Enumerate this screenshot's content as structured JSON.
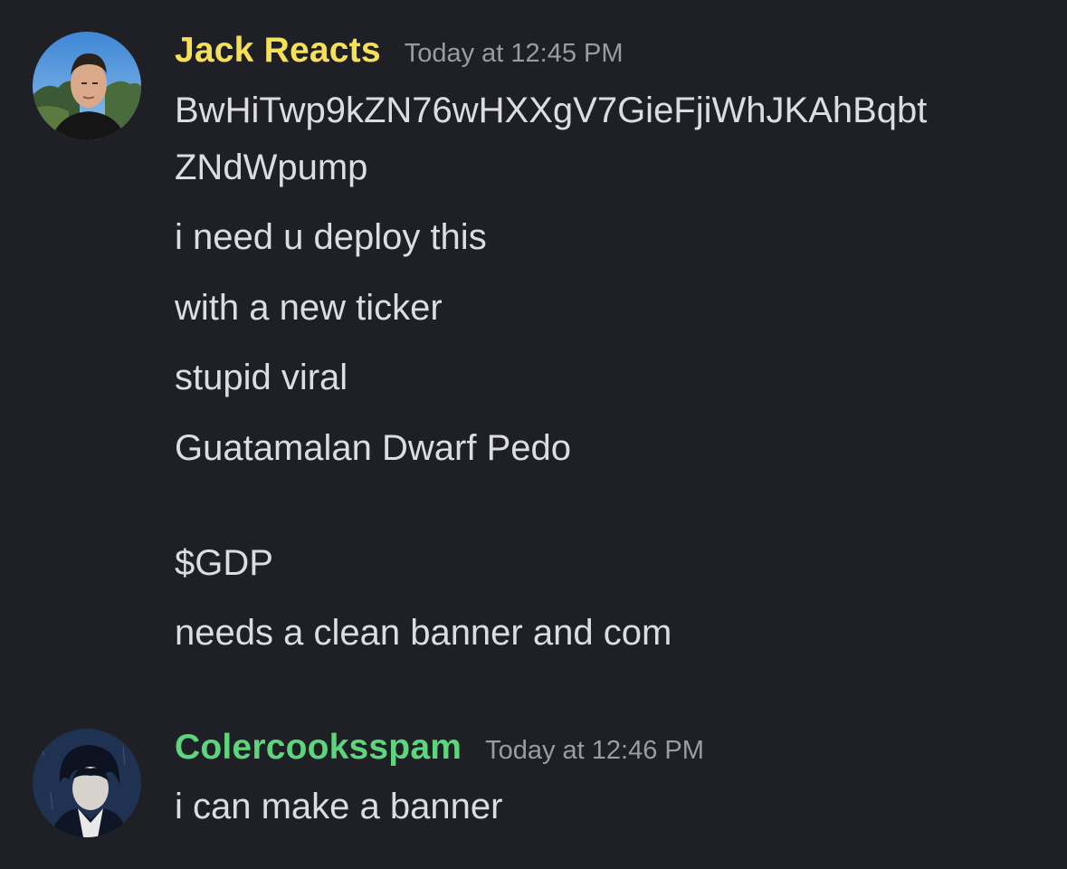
{
  "messages": [
    {
      "username": "Jack Reacts",
      "username_color": "#f6e05a",
      "timestamp": "Today at 12:45 PM",
      "lines": [
        "BwHiTwp9kZN76wHXXgV7GieFjiWhJKAhBqbt",
        "ZNdWpump",
        "i need u deploy this",
        "with a new ticker",
        "stupid viral",
        "Guatamalan Dwarf Pedo",
        "$GDP",
        "needs a clean banner and com"
      ]
    },
    {
      "username": "Colercooksspam",
      "username_color": "#5ed47c",
      "timestamp": "Today at 12:46 PM",
      "lines": [
        "i can make a banner"
      ]
    }
  ]
}
